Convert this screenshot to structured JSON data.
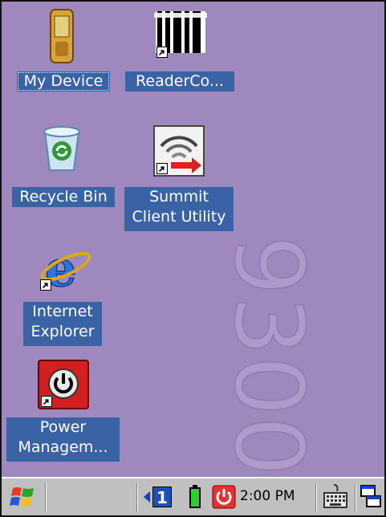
{
  "desktop": {
    "background_color": "#9e88be",
    "watermark_text": "9300",
    "icons": [
      {
        "id": "my-device",
        "label_lines": [
          "My Device"
        ],
        "icon": "pda-device-icon",
        "shortcut": false,
        "focused": true
      },
      {
        "id": "readerco",
        "label_lines": [
          "ReaderCo..."
        ],
        "icon": "barcode-reader-icon",
        "shortcut": true,
        "focused": false
      },
      {
        "id": "recycle-bin",
        "label_lines": [
          "Recycle Bin"
        ],
        "icon": "recycle-bin-icon",
        "shortcut": false,
        "focused": false
      },
      {
        "id": "summit",
        "label_lines": [
          "Summit",
          "Client Utility"
        ],
        "icon": "wifi-signal-icon",
        "shortcut": true,
        "focused": false
      },
      {
        "id": "ie",
        "label_lines": [
          "Internet",
          "Explorer"
        ],
        "icon": "internet-explorer-icon",
        "shortcut": true,
        "focused": false
      },
      {
        "id": "power",
        "label_lines": [
          "Power",
          "Managem..."
        ],
        "icon": "power-button-icon",
        "shortcut": true,
        "focused": false
      }
    ]
  },
  "taskbar": {
    "start_icon": "windows-flag-icon",
    "tray": {
      "badge_number": "1",
      "clock": "2:00 PM",
      "icons": [
        "volume-left-arrow-icon",
        "battery-icon",
        "power-icon",
        "keyboard-icon",
        "desktop-switch-icon"
      ]
    }
  }
}
